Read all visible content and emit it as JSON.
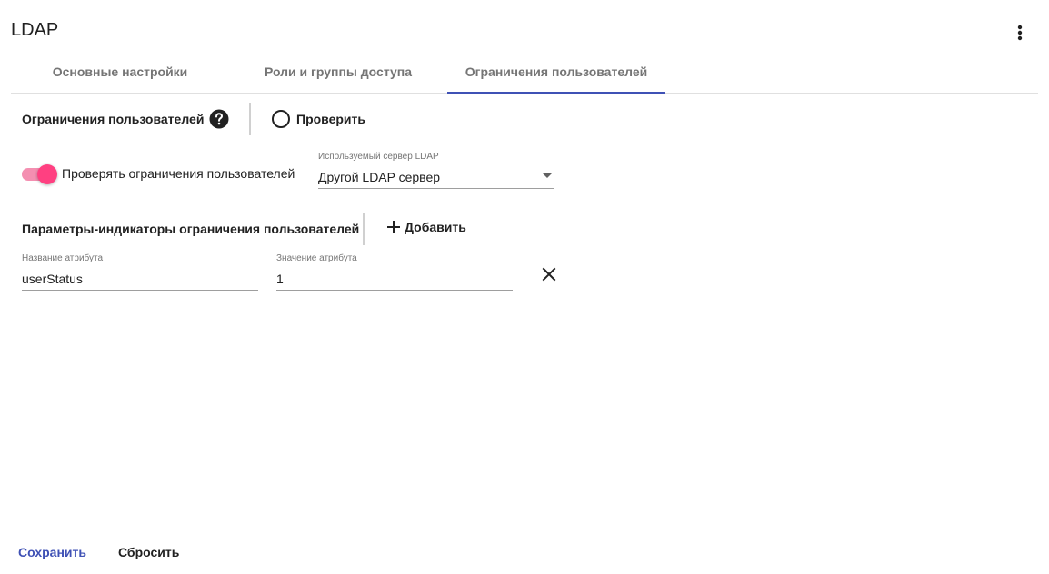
{
  "header": {
    "title": "LDAP",
    "menu_icon": "more-vert-icon"
  },
  "tabs": [
    {
      "label": "Основные настройки",
      "active": false
    },
    {
      "label": "Роли и группы доступа",
      "active": false
    },
    {
      "label": "Ограничения пользователей",
      "active": true
    }
  ],
  "restrictions": {
    "title": "Ограничения пользователей",
    "help_icon": "help-icon",
    "check_label": "Проверить",
    "check_icon": "radio-circle-icon"
  },
  "toggle": {
    "label": "Проверять ограничения пользователей",
    "checked": true
  },
  "ldap_server": {
    "label": "Используемый сервер LDAP",
    "value": "Другой LDAP сервер"
  },
  "params": {
    "title": "Параметры-индикаторы ограничения пользователей",
    "add_label": "Добавить",
    "add_icon": "plus-icon",
    "rows": [
      {
        "name_label": "Название атрибута",
        "name_value": "userStatus",
        "value_label": "Значение атрибута",
        "value_value": "1",
        "remove_icon": "close-icon"
      }
    ]
  },
  "footer": {
    "save_label": "Сохранить",
    "reset_label": "Сбросить"
  },
  "colors": {
    "accent": "#3f51b5",
    "toggle_thumb": "#ff4081",
    "toggle_track": "#f48fb1"
  }
}
